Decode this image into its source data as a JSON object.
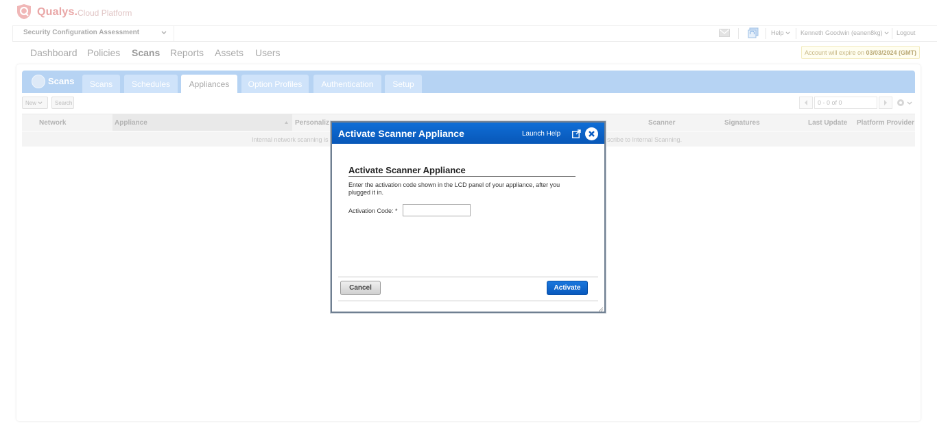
{
  "brand": {
    "name": "Qualys.",
    "subtitle": "Cloud Platform"
  },
  "module_bar": {
    "module": "Security Configuration Assessment",
    "help": "Help",
    "user": "Kenneth Goodwin (eanen8kg)",
    "logout": "Logout"
  },
  "nav": {
    "items": [
      "Dashboard",
      "Policies",
      "Scans",
      "Reports",
      "Assets",
      "Users"
    ],
    "active": "Scans"
  },
  "expire_notice": {
    "prefix": "Account will expire on",
    "date": "03/03/2024 (GMT)"
  },
  "tabs": {
    "title": "Scans",
    "items": [
      "Scans",
      "Schedules",
      "Appliances",
      "Option Profiles",
      "Authentication",
      "Setup"
    ],
    "active": "Appliances"
  },
  "toolbar": {
    "new_label": "New",
    "search_label": "Search",
    "pager_text": "0 - 0 of 0"
  },
  "grid": {
    "columns": [
      "Network",
      "Appliance",
      "Personaliz",
      "Scanner",
      "Signatures",
      "Last Update",
      "Platform Provider"
    ],
    "row_message_left": "Internal network scanning is",
    "row_message_right": "scribe to Internal Scanning."
  },
  "dialog": {
    "title": "Activate Scanner Appliance",
    "launch_help": "Launch Help",
    "heading": "Activate Scanner Appliance",
    "description": "Enter the activation code shown in the LCD panel of your appliance, after you plugged it in.",
    "activation_label": "Activation Code: *",
    "activation_value": "",
    "cancel_label": "Cancel",
    "activate_label": "Activate"
  },
  "colors": {
    "brand": "#e9a6a6",
    "tab_strip": "#b6d3f3",
    "dialog_title": "#0a62c9",
    "activate_button": "#0959bd"
  }
}
